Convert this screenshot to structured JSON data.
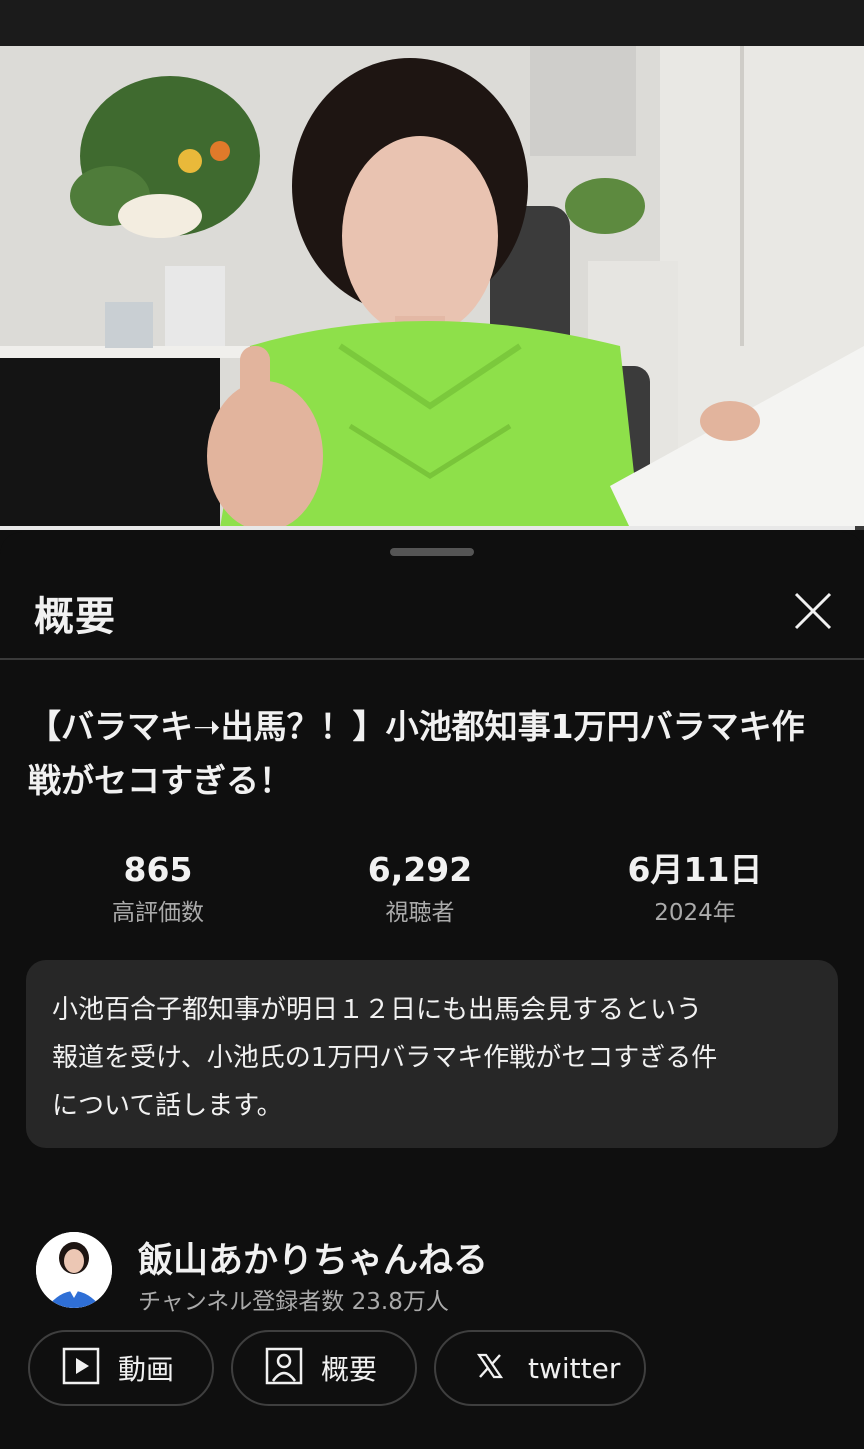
{
  "video": {
    "progress_fraction": 0.99
  },
  "sheet": {
    "title": "概要",
    "close_icon": "close-icon"
  },
  "video_info": {
    "title": "【バラマキ➝出馬？！】小池都知事1万円バラマキ作戦がセコすぎる！",
    "likes": {
      "value": "865",
      "label": "高評価数"
    },
    "views": {
      "value": "6,292",
      "label": "視聴者"
    },
    "date": {
      "value": "6月11日",
      "label": "2024年"
    }
  },
  "description": "小池百合子都知事が明日１２日にも出馬会見するという\n報道を受け、小池氏の1万円バラマキ作戦がセコすぎる件\nについて話します。",
  "channel": {
    "name": "飯山あかりちゃんねる",
    "subscribers": "チャンネル登録者数 23.8万人"
  },
  "links": [
    {
      "label": "動画",
      "icon": "play-square-icon"
    },
    {
      "label": "概要",
      "icon": "person-square-icon"
    },
    {
      "label": "twitter",
      "icon": "x-logo-icon"
    }
  ],
  "colors": {
    "background": "#0f0f0f",
    "card": "#272727",
    "secondary_text": "#aaaaaa",
    "shirt_green": "#8ee04a"
  }
}
